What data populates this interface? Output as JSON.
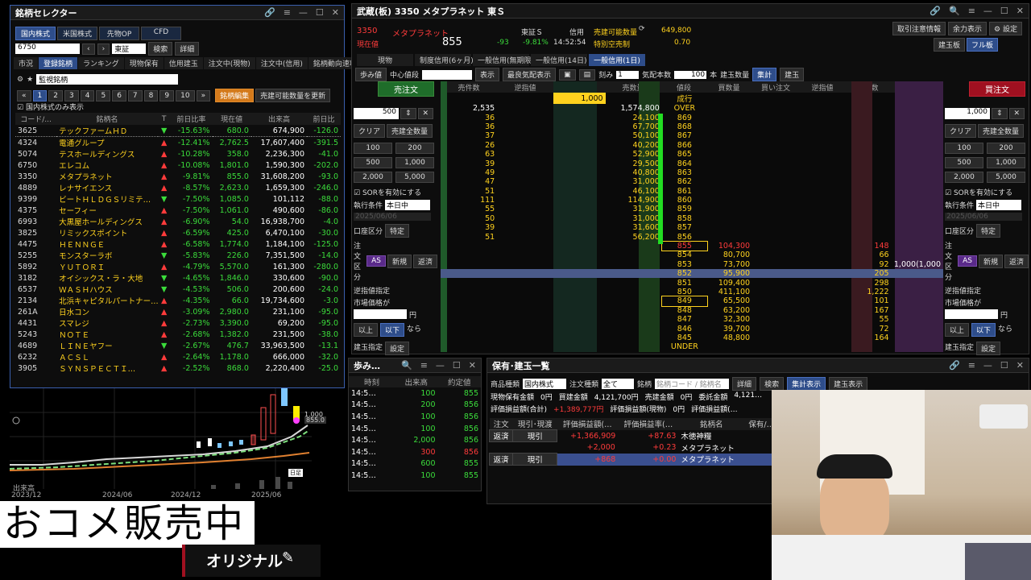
{
  "selector": {
    "title": "銘柄セレクター",
    "tabs": [
      "国内株式",
      "米国株式",
      "先物OP",
      "CFD"
    ],
    "code_input": "6750",
    "exchange": "東証",
    "search_btn": "検索",
    "detail_btn": "詳細",
    "subtabs": [
      "市況",
      "登録銘柄",
      "ランキング",
      "現物保有",
      "信用建玉",
      "注文中(現物)",
      "注文中(信用)",
      "銘柄動向速報"
    ],
    "list_select": "監視銘柄",
    "pages": [
      "1",
      "2",
      "3",
      "4",
      "5",
      "6",
      "7",
      "8",
      "9",
      "10"
    ],
    "edit_btn": "銘柄編集",
    "update_btn": "売建可能数量を更新",
    "only_domestic": "国内株式のみ表示",
    "headers": [
      "コード/...",
      "銘柄名",
      "T",
      "前日比率",
      "現在値",
      "出来高",
      "前日比"
    ],
    "rows": [
      {
        "code": "3625",
        "name": "テックファームＨＤ",
        "pct": "-15.63%",
        "price": "680.0",
        "vol": "674,900",
        "chg": "-126.0",
        "dir": "dn"
      },
      {
        "code": "4324",
        "name": "電通グループ",
        "pct": "-12.41%",
        "price": "2,762.5",
        "vol": "17,607,400",
        "chg": "-391.5",
        "dir": "up"
      },
      {
        "code": "5074",
        "name": "テスホールディングス",
        "pct": "-10.28%",
        "price": "358.0",
        "vol": "2,236,300",
        "chg": "-41.0",
        "dir": "up"
      },
      {
        "code": "6750",
        "name": "エレコム",
        "pct": "-10.08%",
        "price": "1,801.0",
        "vol": "1,590,300",
        "chg": "-202.0",
        "dir": "up"
      },
      {
        "code": "3350",
        "name": "メタプラネット",
        "pct": "-9.81%",
        "price": "855.0",
        "vol": "31,608,200",
        "chg": "-93.0",
        "dir": "up"
      },
      {
        "code": "4889",
        "name": "レナサイエンス",
        "pct": "-8.57%",
        "price": "2,623.0",
        "vol": "1,659,300",
        "chg": "-246.0",
        "dir": "up"
      },
      {
        "code": "9399",
        "name": "ビートＨＬＤＧＳリミテ…",
        "pct": "-7.50%",
        "price": "1,085.0",
        "vol": "101,112",
        "chg": "-88.0",
        "dir": "dn"
      },
      {
        "code": "4375",
        "name": "セーフィー",
        "pct": "-7.50%",
        "price": "1,061.0",
        "vol": "490,600",
        "chg": "-86.0",
        "dir": "up"
      },
      {
        "code": "6993",
        "name": "大黒屋ホールディングス",
        "pct": "-6.90%",
        "price": "54.0",
        "vol": "16,938,700",
        "chg": "-4.0",
        "dir": "up"
      },
      {
        "code": "3825",
        "name": "リミックスポイント",
        "pct": "-6.59%",
        "price": "425.0",
        "vol": "6,470,100",
        "chg": "-30.0",
        "dir": "up"
      },
      {
        "code": "4475",
        "name": "ＨＥＮＮＧＥ",
        "pct": "-6.58%",
        "price": "1,774.0",
        "vol": "1,184,100",
        "chg": "-125.0",
        "dir": "up"
      },
      {
        "code": "5255",
        "name": "モンスターラボ",
        "pct": "-5.83%",
        "price": "226.0",
        "vol": "7,351,500",
        "chg": "-14.0",
        "dir": "dn"
      },
      {
        "code": "5892",
        "name": "ＹＵＴＯＲＩ",
        "pct": "-4.79%",
        "price": "5,570.0",
        "vol": "161,300",
        "chg": "-280.0",
        "dir": "up"
      },
      {
        "code": "3182",
        "name": "オイシックス・ラ・大地",
        "pct": "-4.65%",
        "price": "1,846.0",
        "vol": "330,600",
        "chg": "-90.0",
        "dir": "dn"
      },
      {
        "code": "6537",
        "name": "ＷＡＳＨハウス",
        "pct": "-4.53%",
        "price": "506.0",
        "vol": "200,600",
        "chg": "-24.0",
        "dir": "dn"
      },
      {
        "code": "2134",
        "name": "北浜キャピタルパートナー…",
        "pct": "-4.35%",
        "price": "66.0",
        "vol": "19,734,600",
        "chg": "-3.0",
        "dir": "up"
      },
      {
        "code": "261A",
        "name": "日水コン",
        "pct": "-3.09%",
        "price": "2,980.0",
        "vol": "231,100",
        "chg": "-95.0",
        "dir": "up"
      },
      {
        "code": "4431",
        "name": "スマレジ",
        "pct": "-2.73%",
        "price": "3,390.0",
        "vol": "69,200",
        "chg": "-95.0",
        "dir": "up"
      },
      {
        "code": "5243",
        "name": "ＮＯＴＥ",
        "pct": "-2.68%",
        "price": "1,382.0",
        "vol": "231,500",
        "chg": "-38.0",
        "dir": "up"
      },
      {
        "code": "4689",
        "name": "ＬＩＮＥヤフー",
        "pct": "-2.67%",
        "price": "476.7",
        "vol": "33,963,500",
        "chg": "-13.1",
        "dir": "dn"
      },
      {
        "code": "6232",
        "name": "ＡＣＳＬ",
        "pct": "-2.64%",
        "price": "1,178.0",
        "vol": "666,000",
        "chg": "-32.0",
        "dir": "up"
      },
      {
        "code": "3905",
        "name": "ＳＹＮＳＰＥＣＴＩ…",
        "pct": "-2.52%",
        "price": "868.0",
        "vol": "2,220,400",
        "chg": "-25.0",
        "dir": "up"
      }
    ]
  },
  "chart": {
    "price_label": "855.0",
    "level": "1,000",
    "xlabels": [
      "2023/12",
      "2024/06",
      "2024/12",
      "2025/06"
    ],
    "vol_label": "出来高",
    "tag": "日足"
  },
  "board": {
    "title": "武蔵(板) 3350 メタプラネット 東Ｓ",
    "code": "3350",
    "name": "メタプラネット",
    "price_label": "現在値",
    "price": "855",
    "chg": "-93",
    "pct": "-9.81%",
    "time": "14:52:54",
    "market": "東証Ｓ",
    "credit": "信用",
    "sell_avail_label": "売建可能数量",
    "sell_avail": "649,800",
    "special": "特別空売制",
    "ratio": "0.70",
    "top_btns": [
      "取引注意情報",
      "余力表示",
      "設定"
    ],
    "top_btns2": [
      "建玉板",
      "フル板"
    ],
    "tabs": [
      "現物",
      "制度信用(6ヶ月)",
      "一般信用(無期限)",
      "一般信用(14日)",
      "一般信用(1日)"
    ],
    "tb": {
      "ayumi": "歩み値",
      "center": "中心値段",
      "show": "表示",
      "best": "最良気配表示",
      "tick": "刻み",
      "tick_v": "1",
      "qty": "気配本数",
      "qty_v": "100",
      "unit": "本",
      "tate": "建玉数量",
      "shukei": "集計",
      "tate2": "建玉"
    },
    "headers": [
      "売件数",
      "逆指値",
      "売り注文",
      "売数量",
      "値段",
      "買数量",
      "買い注文",
      "逆指値",
      "買件数",
      "建玉数量"
    ],
    "market_row": {
      "price": "成行",
      "sell": "1,000"
    },
    "over": {
      "label": "OVER",
      "sell_cnt": "2,535",
      "sell_qty": "1,574,800"
    },
    "asks": [
      [
        "36",
        "24,100",
        "869"
      ],
      [
        "36",
        "67,700",
        "868"
      ],
      [
        "37",
        "50,100",
        "867"
      ],
      [
        "26",
        "40,200",
        "866"
      ],
      [
        "63",
        "52,900",
        "865"
      ],
      [
        "39",
        "29,500",
        "864"
      ],
      [
        "49",
        "40,800",
        "863"
      ],
      [
        "47",
        "31,000",
        "862"
      ],
      [
        "51",
        "46,100",
        "861"
      ],
      [
        "111",
        "114,900",
        "860"
      ],
      [
        "55",
        "31,900",
        "859"
      ],
      [
        "50",
        "31,000",
        "858"
      ],
      [
        "39",
        "31,600",
        "857"
      ],
      [
        "51",
        "56,200",
        "856"
      ]
    ],
    "bids": [
      [
        "855",
        "104,300",
        "148"
      ],
      [
        "854",
        "80,700",
        "66"
      ],
      [
        "853",
        "73,700",
        "92"
      ],
      [
        "852",
        "95,900",
        "205"
      ],
      [
        "851",
        "109,400",
        "298"
      ],
      [
        "850",
        "411,100",
        "1,222"
      ],
      [
        "849",
        "65,500",
        "101"
      ],
      [
        "848",
        "63,200",
        "167"
      ],
      [
        "847",
        "32,300",
        "55"
      ],
      [
        "846",
        "39,700",
        "72"
      ],
      [
        "845",
        "48,800",
        "164"
      ]
    ],
    "tate_extra": "1,000(1,000",
    "under": "UNDER",
    "sell_panel": {
      "title": "売注文",
      "qty": "500",
      "clear": "クリア",
      "all": "売建全数量",
      "quick": [
        "100",
        "200",
        "500",
        "1,000",
        "2,000",
        "5,000"
      ],
      "sor": "SORを有効にする",
      "exec_label": "執行条件",
      "exec": "本日中",
      "date": "2025/06/06",
      "acct_label": "口座区分",
      "acct": "特定",
      "ord_label": "注文区分",
      "as": "AS",
      "new": "新規",
      "close": "返済",
      "rev_label": "逆指値指定",
      "cond": "市場価格が",
      "yen": "円",
      "above": "以上",
      "below": "以下",
      "nara": "なら",
      "tate_label": "建玉指定",
      "set": "設定",
      "ifd": "IFD/IFOで注文する",
      "order": "注文"
    },
    "buy_panel": {
      "title": "買注文",
      "qty": "1,000",
      "clear": "クリア",
      "all": "売建全数量",
      "quick": [
        "100",
        "200",
        "500",
        "1,000",
        "2,000",
        "5,000"
      ],
      "sor": "SORを有効にする",
      "exec_label": "執行条件",
      "exec": "本日中",
      "date": "2025/06/06",
      "acct_label": "口座区分",
      "acct": "特定",
      "ord_label": "注文区分",
      "as": "AS",
      "new": "新規",
      "close": "返済",
      "rev_label": "逆指値指定",
      "cond": "市場価格が",
      "yen": "円",
      "above": "以上",
      "below": "以下",
      "nara": "なら",
      "tate_label": "建玉指定",
      "set": "設定",
      "ifd": "IFD/IFOで注文する",
      "order": "注文"
    }
  },
  "ayumi": {
    "title": "歩み…",
    "headers": [
      "時刻",
      "出来高",
      "約定値"
    ],
    "rows": [
      [
        "14:5…",
        "100",
        "855",
        "g"
      ],
      [
        "14:5…",
        "200",
        "856",
        "g"
      ],
      [
        "14:5…",
        "100",
        "856",
        "g"
      ],
      [
        "14:5…",
        "100",
        "856",
        "g"
      ],
      [
        "14:5…",
        "2,000",
        "856",
        "g"
      ],
      [
        "14:5…",
        "300",
        "856",
        "r"
      ],
      [
        "14:5…",
        "600",
        "855",
        "g"
      ],
      [
        "14:5…",
        "100",
        "855",
        "g"
      ]
    ]
  },
  "holdings": {
    "title": "保有･建玉一覧",
    "type_label": "商品種類",
    "type": "国内株式",
    "ord_label": "注文種類",
    "ord": "全て",
    "code_label": "銘柄",
    "code_ph": "銘柄コード / 銘柄名",
    "detail": "詳細",
    "search": "検索",
    "sum": "集計表示",
    "tate": "建玉表示",
    "l1": [
      [
        "現物保有金額",
        "0円"
      ],
      [
        "買建金額",
        "4,121,700円"
      ],
      [
        "売建金額",
        "0円"
      ],
      [
        "委託金額",
        "4,121…"
      ]
    ],
    "l2": [
      [
        "評価損益額(合計)",
        "+1,389,777円"
      ],
      [
        "評価損益額(現物)",
        "0円"
      ],
      [
        "評価損益額(…"
      ]
    ],
    "headers": [
      "注文",
      "現引･現渡",
      "評価損益額(…",
      "評価損益率(…",
      "銘柄名",
      "保有/…"
    ],
    "rows": [
      {
        "ord": "返済",
        "hk": "現引",
        "pl": "+1,366,909",
        "rate": "+87.63",
        "name": "木徳神糧",
        "sel": false
      },
      {
        "ord": "",
        "hk": "",
        "pl": "+2,000",
        "rate": "+0.23",
        "name": "メタプラネット",
        "sel": false
      },
      {
        "ord": "返済",
        "hk": "現引",
        "pl": "+868",
        "rate": "+0.00",
        "name": "メタプラネット",
        "sel": true
      }
    ]
  },
  "overlay": {
    "caption": "おコメ販売中",
    "original": "オリジナル"
  }
}
